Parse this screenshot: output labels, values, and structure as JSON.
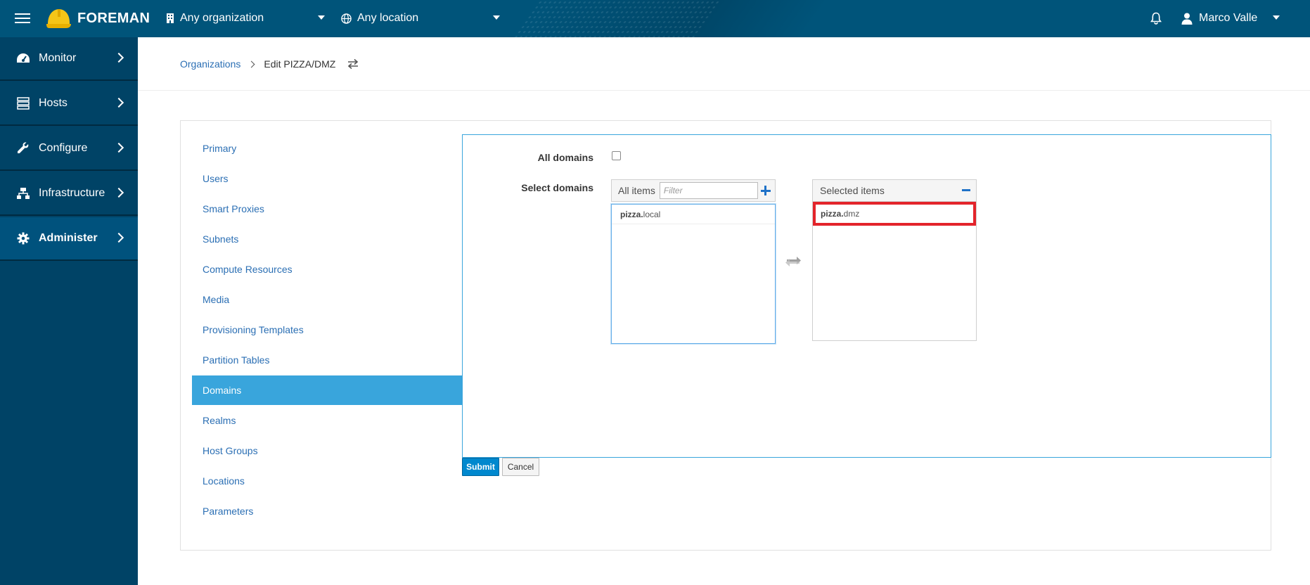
{
  "navbar": {
    "brand": "FOREMAN",
    "organization": "Any organization",
    "location": "Any location",
    "user": "Marco Valle"
  },
  "sidebar": {
    "items": [
      {
        "label": "Monitor",
        "icon": "dashboard-icon"
      },
      {
        "label": "Hosts",
        "icon": "server-icon"
      },
      {
        "label": "Configure",
        "icon": "wrench-icon"
      },
      {
        "label": "Infrastructure",
        "icon": "network-icon"
      },
      {
        "label": "Administer",
        "icon": "gear-icon",
        "active": true
      }
    ]
  },
  "breadcrumb": {
    "parent": "Organizations",
    "current": "Edit PIZZA/DMZ"
  },
  "tabs": [
    {
      "label": "Primary"
    },
    {
      "label": "Users"
    },
    {
      "label": "Smart Proxies"
    },
    {
      "label": "Subnets"
    },
    {
      "label": "Compute Resources"
    },
    {
      "label": "Media"
    },
    {
      "label": "Provisioning Templates"
    },
    {
      "label": "Partition Tables"
    },
    {
      "label": "Domains",
      "active": true
    },
    {
      "label": "Realms"
    },
    {
      "label": "Host Groups"
    },
    {
      "label": "Locations"
    },
    {
      "label": "Parameters"
    }
  ],
  "form": {
    "all_label": "All domains",
    "select_label": "Select domains",
    "all_items_label": "All items",
    "filter_placeholder": "Filter",
    "selected_items_label": "Selected items",
    "available": [
      {
        "bold": "pizza.",
        "rest": "local"
      }
    ],
    "selected": [
      {
        "bold": "pizza.",
        "rest": "dmz"
      }
    ]
  },
  "buttons": {
    "submit": "Submit",
    "cancel": "Cancel"
  },
  "colors": {
    "navbar": "#00547a",
    "sidebar": "#004366",
    "active_tab": "#39a5dc",
    "link": "#2b6fb4",
    "highlight": "#e3242b"
  }
}
